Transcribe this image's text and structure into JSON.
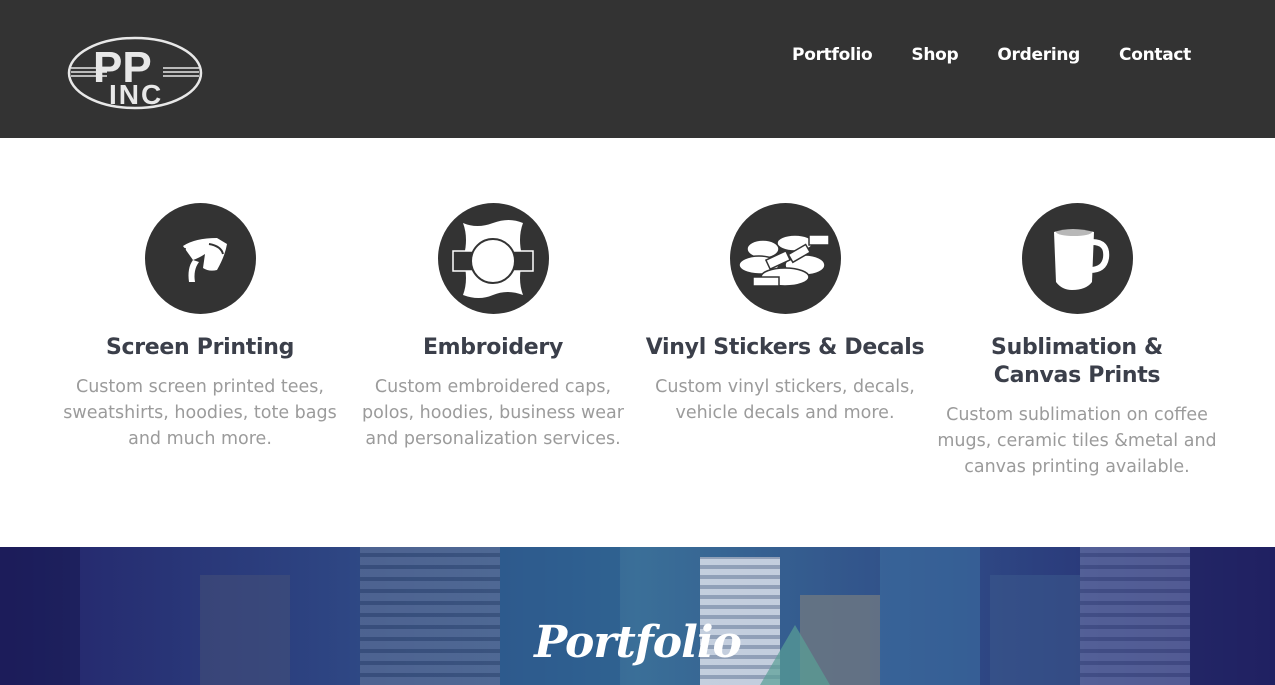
{
  "header": {
    "logo_alt": "PP INC",
    "logo_text_top": "PP",
    "logo_text_bottom": "INC",
    "nav": [
      {
        "label": "Portfolio"
      },
      {
        "label": "Shop"
      },
      {
        "label": "Ordering"
      },
      {
        "label": "Contact"
      }
    ]
  },
  "services": [
    {
      "title": "Screen Printing",
      "description": "Custom screen printed tees, sweatshirts, hoodies, tote bags and much more.",
      "icon": "squeegee-icon"
    },
    {
      "title": "Embroidery",
      "description": "Custom embroidered caps, polos, hoodies, business wear and personalization services.",
      "icon": "embroidery-hoop-icon"
    },
    {
      "title": "Vinyl Stickers & Decals",
      "description": "Custom vinyl stickers, decals, vehicle decals and more.",
      "icon": "stickers-icon"
    },
    {
      "title": "Sublimation & Canvas Prints",
      "description": "Custom sublimation on coffee mugs, ceramic tiles &metal and canvas printing available.",
      "icon": "mug-icon"
    }
  ],
  "portfolio": {
    "title": "Portfolio"
  },
  "colors": {
    "header_bg": "#333333",
    "icon_circle": "#333333",
    "title_text": "#3b3f4a",
    "body_text": "#9b9b9b",
    "portfolio_overlay": "#23236a"
  }
}
